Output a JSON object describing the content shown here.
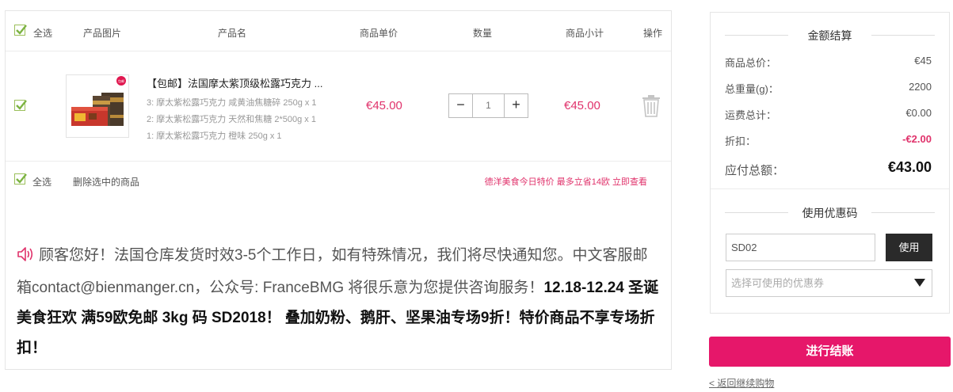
{
  "header": {
    "select_all": "全选",
    "col_image": "产品图片",
    "col_name": "产品名",
    "col_unit_price": "商品单价",
    "col_quantity": "数量",
    "col_subtotal": "商品小计",
    "col_action": "操作"
  },
  "item": {
    "title": "【包邮】法国摩太紫顶级松露巧克力 ...",
    "options": [
      "3: 摩太紫松露巧克力 咸黄油焦糖碎 250g x 1",
      "2: 摩太紫松露巧克力 天然和焦糖 2*500g x 1",
      "1: 摩太紫松露巧克力 橙味 250g x 1"
    ],
    "unit_price": "€45.00",
    "quantity": "1",
    "subtotal": "€45.00",
    "image_badge": "包邮",
    "icons": {
      "delete": "trash-icon",
      "check": "check-icon"
    }
  },
  "footer": {
    "select_all": "全选",
    "delete_selected": "删除选中的商品",
    "promo_link": "德洋美食今日特价 最多立省14欧 立即查看"
  },
  "notice": {
    "icon": "speaker-icon",
    "text": "顾客您好！法国仓库发货时效3-5个工作日，如有特殊情况，我们将尽快通知您。中文客服邮箱contact@bienmanger.cn，公众号: FranceBMG 将很乐意为您提供咨询服务！",
    "bold": "12.18-12.24 圣诞美食狂欢 满59欧免邮 3kg 码 SD2018！ 叠加奶粉、鹅肝、坚果油专场9折！特价商品不享专场折扣！"
  },
  "summary": {
    "title": "金额结算",
    "rows": [
      {
        "label": "商品总价：",
        "value": "€45"
      },
      {
        "label": "总重量(g)：",
        "value": "2200"
      },
      {
        "label": "运费总计：",
        "value": "€0.00"
      },
      {
        "label": "折扣：",
        "value": "-€2.00"
      }
    ],
    "total_label": "应付总额：",
    "total_value": "€43.00",
    "coupon_title": "使用优惠码",
    "coupon_value": "SD02",
    "use_button": "使用",
    "coupon_select": "选择可使用的优惠券"
  },
  "checkout_button": "进行结账",
  "back_link": "< 返回继续购物",
  "colors": {
    "accent": "#e6176a",
    "price": "#e0326b",
    "check": "#7cb342"
  }
}
